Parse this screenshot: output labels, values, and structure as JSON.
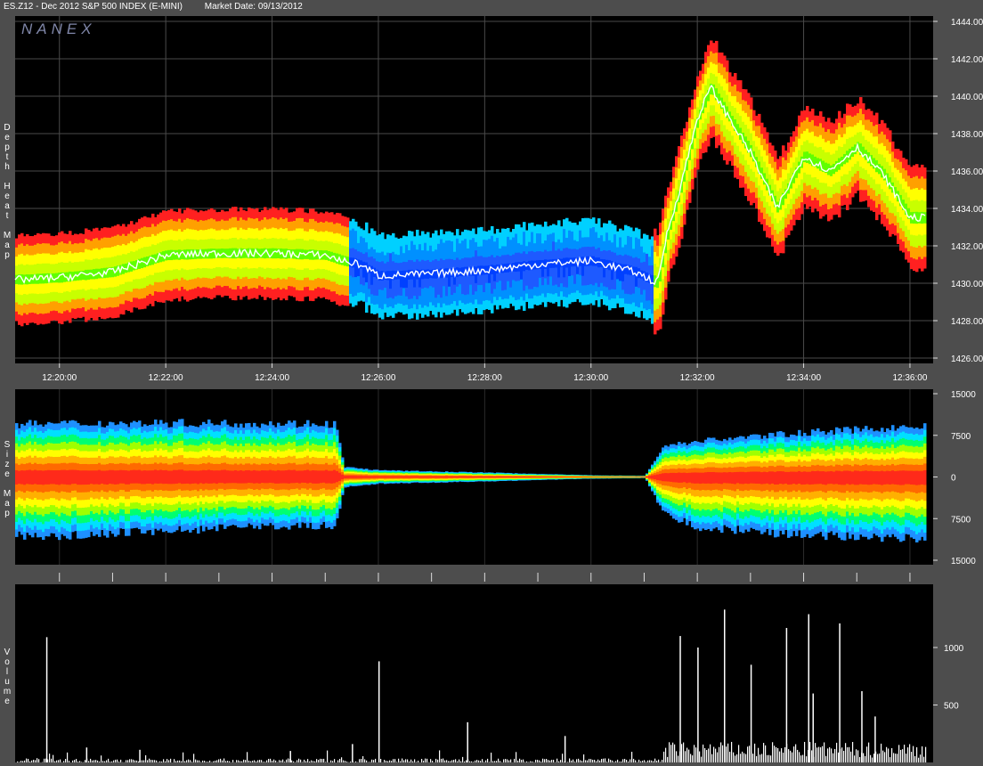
{
  "header": {
    "symbol": "ES.Z12 - Dec 2012 S&P 500 INDEX (E-MINI)",
    "market_date": "Market Date: 09/13/2012"
  },
  "watermark": "NANEX",
  "colors": {
    "background": "#4d4d4d",
    "plot_bg": "#000000",
    "grid": "#4a4a4a",
    "heat_low": "#1e5aff",
    "heat_high": "#ff2a1a",
    "volume": "#ffffff"
  },
  "panel_labels": {
    "depth": "Depth Heat Map",
    "size": "Size Map",
    "volume": "Volume"
  },
  "chart_data": [
    {
      "type": "heatmap",
      "title": "Depth Heat Map",
      "x_tick_labels": [
        "12:20:00",
        "12:22:00",
        "12:24:00",
        "12:26:00",
        "12:28:00",
        "12:30:00",
        "12:32:00",
        "12:34:00",
        "12:36:00"
      ],
      "y_tick_labels": [
        "1426.00",
        "1428.00",
        "1430.00",
        "1432.00",
        "1434.00",
        "1436.00",
        "1438.00",
        "1440.00",
        "1442.00",
        "1444.00"
      ],
      "ylim": [
        1426,
        1444
      ],
      "grid": true,
      "price_series": {
        "name": "price",
        "x": [
          "12:19:20",
          "12:20:00",
          "12:21:00",
          "12:22:00",
          "12:23:00",
          "12:24:00",
          "12:25:00",
          "12:25:20",
          "12:25:40",
          "12:26:00",
          "12:27:00",
          "12:28:00",
          "12:29:00",
          "12:30:00",
          "12:30:50",
          "12:31:15",
          "12:31:25",
          "12:31:40",
          "12:32:00",
          "12:32:15",
          "12:32:30",
          "12:33:00",
          "12:33:30",
          "12:34:00",
          "12:34:30",
          "12:35:00",
          "12:35:30",
          "12:36:00"
        ],
        "y": [
          1430.2,
          1430.3,
          1430.6,
          1431.5,
          1431.6,
          1431.6,
          1431.5,
          1431.2,
          1431.0,
          1430.4,
          1430.5,
          1430.7,
          1431.0,
          1431.2,
          1430.6,
          1430.0,
          1432.5,
          1435.0,
          1438.8,
          1440.5,
          1439.3,
          1437.0,
          1434.0,
          1436.8,
          1436.0,
          1437.3,
          1435.8,
          1433.5
        ]
      }
    },
    {
      "type": "heatmap",
      "title": "Size Map",
      "y_tick_labels": [
        "15000",
        "7500",
        "0",
        "7500",
        "15000"
      ],
      "ylim": [
        -15000,
        15000
      ],
      "envelope": {
        "x": [
          "12:19:20",
          "12:20:00",
          "12:22:00",
          "12:24:00",
          "12:25:10",
          "12:25:20",
          "12:26:00",
          "12:28:00",
          "12:30:00",
          "12:31:00",
          "12:31:20",
          "12:32:00",
          "12:34:00",
          "12:36:00"
        ],
        "upper": [
          9500,
          9600,
          9700,
          9600,
          9600,
          1800,
          1200,
          800,
          300,
          200,
          5500,
          6500,
          8000,
          9000
        ],
        "lower": [
          -10500,
          -10500,
          -9700,
          -8800,
          -8800,
          -1800,
          -1200,
          -800,
          -300,
          -200,
          -6500,
          -9000,
          -10500,
          -11000
        ]
      }
    },
    {
      "type": "bar",
      "title": "Volume",
      "y_tick_labels": [
        "500",
        "1000"
      ],
      "ylim": [
        0,
        1550
      ],
      "x": [
        "12:19:45",
        "12:20:30",
        "12:21:30",
        "12:24:20",
        "12:25:30",
        "12:26:00",
        "12:27:40",
        "12:29:30",
        "12:31:40",
        "12:32:00",
        "12:32:30",
        "12:33:00",
        "12:33:40",
        "12:34:05",
        "12:34:10",
        "12:34:40",
        "12:35:05",
        "12:35:20"
      ],
      "values": [
        1090,
        130,
        110,
        100,
        160,
        880,
        350,
        230,
        1100,
        1000,
        1330,
        850,
        1170,
        1290,
        600,
        1210,
        620,
        400
      ]
    }
  ]
}
